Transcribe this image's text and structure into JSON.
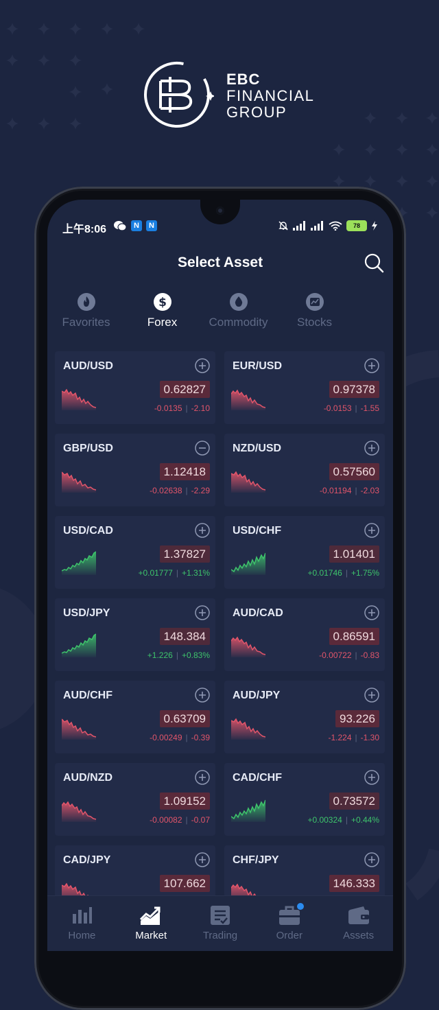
{
  "brand": {
    "line1": "EBC",
    "line2": "FINANCIAL",
    "line3": "GROUP"
  },
  "status_bar": {
    "time": "上午8:06",
    "chip_a": "N",
    "chip_b": "N",
    "battery": "78"
  },
  "header": {
    "title": "Select Asset",
    "search_icon": "search-icon"
  },
  "tabs": [
    {
      "label": "Favorites",
      "icon": "fire-icon"
    },
    {
      "label": "Forex",
      "icon": "dollar-icon",
      "active": true
    },
    {
      "label": "Commodity",
      "icon": "drop-icon"
    },
    {
      "label": "Stocks",
      "icon": "stock-chart-icon"
    }
  ],
  "colors": {
    "down": "#e2556a",
    "up": "#3ec46b",
    "price_bg": "#5a2a3a",
    "card_bg": "#222b48",
    "accent_dot": "#2b8cf0"
  },
  "assets": [
    {
      "symbol": "AUD/USD",
      "price": "0.62827",
      "change": "-0.0135",
      "percent": "-2.10",
      "dir": "down",
      "action": "plus"
    },
    {
      "symbol": "EUR/USD",
      "price": "0.97378",
      "change": "-0.0153",
      "percent": "-1.55",
      "dir": "down",
      "action": "plus"
    },
    {
      "symbol": "GBP/USD",
      "price": "1.12418",
      "change": "-0.02638",
      "percent": "-2.29",
      "dir": "down",
      "action": "minus"
    },
    {
      "symbol": "NZD/USD",
      "price": "0.57560",
      "change": "-0.01194",
      "percent": "-2.03",
      "dir": "down",
      "action": "plus"
    },
    {
      "symbol": "USD/CAD",
      "price": "1.37827",
      "change": "+0.01777",
      "percent": "+1.31%",
      "dir": "up",
      "action": "plus"
    },
    {
      "symbol": "USD/CHF",
      "price": "1.01401",
      "change": "+0.01746",
      "percent": "+1.75%",
      "dir": "up",
      "action": "plus"
    },
    {
      "symbol": "USD/JPY",
      "price": "148.384",
      "change": "+1.226",
      "percent": "+0.83%",
      "dir": "up",
      "action": "plus"
    },
    {
      "symbol": "AUD/CAD",
      "price": "0.86591",
      "change": "-0.00722",
      "percent": "-0.83",
      "dir": "down",
      "action": "plus"
    },
    {
      "symbol": "AUD/CHF",
      "price": "0.63709",
      "change": "-0.00249",
      "percent": "-0.39",
      "dir": "down",
      "action": "plus"
    },
    {
      "symbol": "AUD/JPY",
      "price": "93.226",
      "change": "-1.224",
      "percent": "-1.30",
      "dir": "down",
      "action": "plus"
    },
    {
      "symbol": "AUD/NZD",
      "price": "1.09152",
      "change": "-0.00082",
      "percent": "-0.07",
      "dir": "down",
      "action": "plus"
    },
    {
      "symbol": "CAD/CHF",
      "price": "0.73572",
      "change": "+0.00324",
      "percent": "+0.44%",
      "dir": "up",
      "action": "plus"
    },
    {
      "symbol": "CAD/JPY",
      "price": "107.662",
      "change": "",
      "percent": "",
      "dir": "down",
      "action": "plus"
    },
    {
      "symbol": "CHF/JPY",
      "price": "146.333",
      "change": "",
      "percent": "",
      "dir": "down",
      "action": "plus"
    }
  ],
  "bottom_nav": [
    {
      "label": "Home",
      "icon": "bar-chart-icon"
    },
    {
      "label": "Market",
      "icon": "market-trend-icon",
      "active": true
    },
    {
      "label": "Trading",
      "icon": "clipboard-icon"
    },
    {
      "label": "Order",
      "icon": "briefcase-icon",
      "badge": true
    },
    {
      "label": "Assets",
      "icon": "wallet-icon"
    }
  ]
}
